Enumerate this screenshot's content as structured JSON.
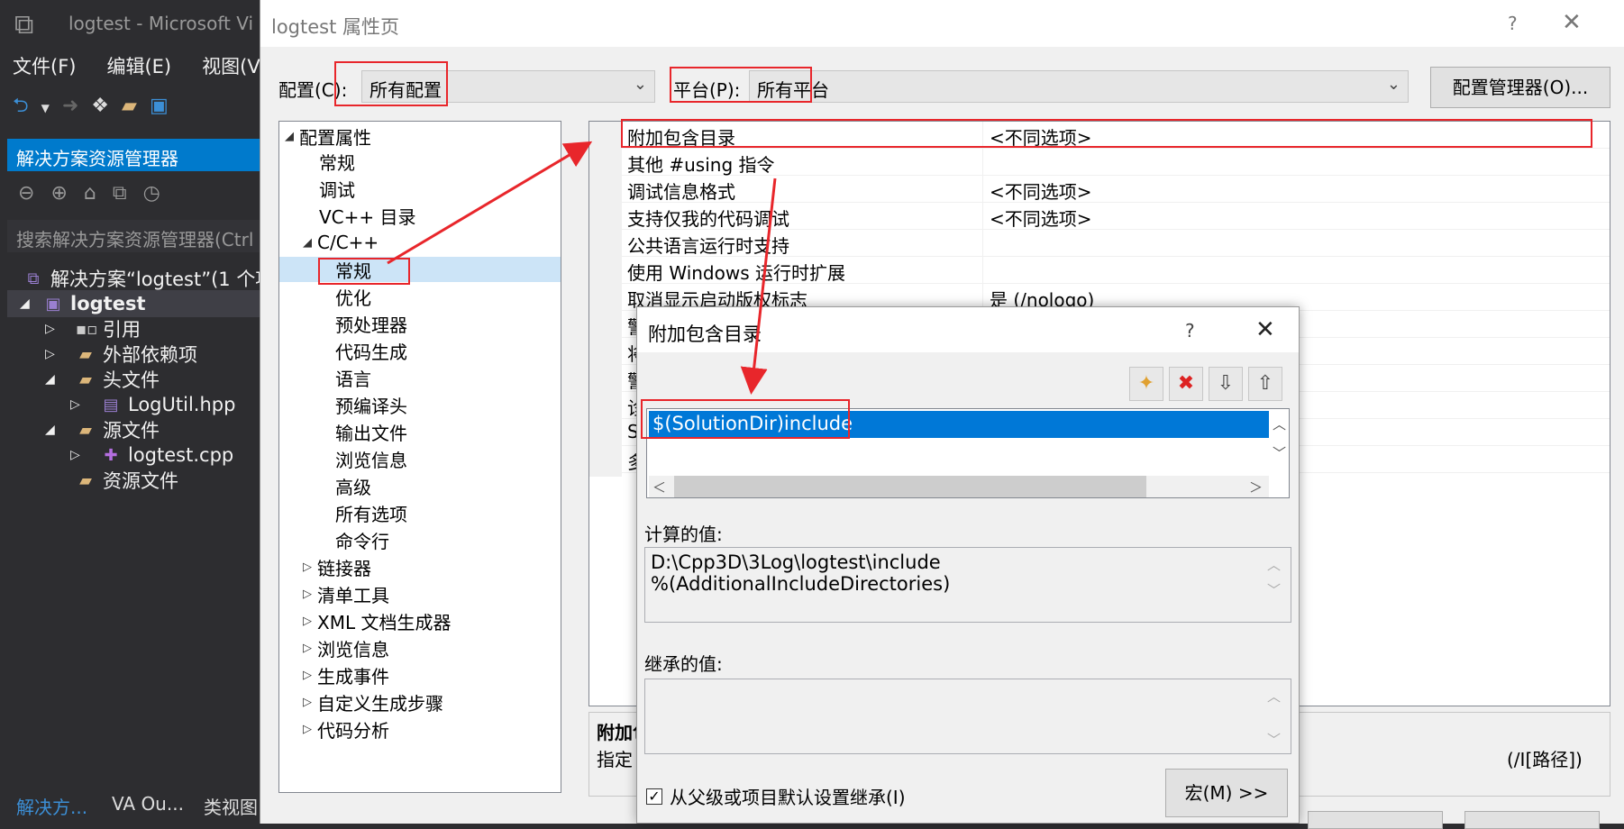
{
  "vs": {
    "title": "logtest - Microsoft Vi",
    "menu": [
      "文件(F)",
      "编辑(E)",
      "视图(V)"
    ],
    "solution_explorer": {
      "header": "解决方案资源管理器",
      "search_placeholder": "搜索解决方案资源管理器(Ctrl",
      "items": [
        {
          "label": "解决方案“logtest”(1 个项",
          "icon": "solution-icon"
        },
        {
          "label": "logtest",
          "icon": "project-icon"
        },
        {
          "label": "引用",
          "icon": "references-icon"
        },
        {
          "label": "外部依赖项",
          "icon": "external-deps-icon"
        },
        {
          "label": "头文件",
          "icon": "folder-icon"
        },
        {
          "label": "LogUtil.hpp",
          "icon": "file-icon"
        },
        {
          "label": "源文件",
          "icon": "folder-icon"
        },
        {
          "label": "logtest.cpp",
          "icon": "cpp-file-icon"
        },
        {
          "label": "资源文件",
          "icon": "folder-icon"
        }
      ],
      "tabs": [
        "解决方...",
        "VA Ou...",
        "类视图"
      ]
    }
  },
  "dialog": {
    "title": "logtest 属性页",
    "help": "?",
    "close": "✕",
    "config_label": "配置(C):",
    "config_value": "所有配置",
    "platform_label": "平台(P):",
    "platform_value": "所有平台",
    "config_manager": "配置管理器(O)...",
    "tree": [
      {
        "label": "配置属性",
        "toggle": "◢",
        "level": 0
      },
      {
        "label": "常规",
        "level": 1
      },
      {
        "label": "调试",
        "level": 1
      },
      {
        "label": "VC++ 目录",
        "level": 1
      },
      {
        "label": "C/C++",
        "toggle": "◢",
        "level": 1
      },
      {
        "label": "常规",
        "level": 2,
        "selected": true
      },
      {
        "label": "优化",
        "level": 2
      },
      {
        "label": "预处理器",
        "level": 2
      },
      {
        "label": "代码生成",
        "level": 2
      },
      {
        "label": "语言",
        "level": 2
      },
      {
        "label": "预编译头",
        "level": 2
      },
      {
        "label": "输出文件",
        "level": 2
      },
      {
        "label": "浏览信息",
        "level": 2
      },
      {
        "label": "高级",
        "level": 2
      },
      {
        "label": "所有选项",
        "level": 2
      },
      {
        "label": "命令行",
        "level": 2
      },
      {
        "label": "链接器",
        "toggle": "▷",
        "level": 1
      },
      {
        "label": "清单工具",
        "toggle": "▷",
        "level": 1
      },
      {
        "label": "XML 文档生成器",
        "toggle": "▷",
        "level": 1
      },
      {
        "label": "浏览信息",
        "toggle": "▷",
        "level": 1
      },
      {
        "label": "生成事件",
        "toggle": "▷",
        "level": 1
      },
      {
        "label": "自定义生成步骤",
        "toggle": "▷",
        "level": 1
      },
      {
        "label": "代码分析",
        "toggle": "▷",
        "level": 1
      }
    ],
    "grid": [
      {
        "name": "附加包含目录",
        "value": "<不同选项>"
      },
      {
        "name": "其他 #using 指令",
        "value": ""
      },
      {
        "name": "调试信息格式",
        "value": "<不同选项>"
      },
      {
        "name": "支持仅我的代码调试",
        "value": "<不同选项>"
      },
      {
        "name": "公共语言运行时支持",
        "value": ""
      },
      {
        "name": "使用 Windows 运行时扩展",
        "value": ""
      },
      {
        "name": "取消显示启动版权标志",
        "value": "是 (/nologo)"
      },
      {
        "name": "警",
        "value": ""
      },
      {
        "name": "将",
        "value": ""
      },
      {
        "name": "警",
        "value": ""
      },
      {
        "name": "诊",
        "value": ""
      },
      {
        "name": "S",
        "value": ""
      },
      {
        "name": "多",
        "value": ""
      }
    ],
    "desc_title": "附加包",
    "desc_text": "指定",
    "desc_suffix": "(/I[路径])"
  },
  "sub_dialog": {
    "title": "附加包含目录",
    "help": "?",
    "close": "✕",
    "list_items": [
      "$(SolutionDir)include"
    ],
    "evaluated_label": "计算的值:",
    "evaluated_lines": [
      "D:\\Cpp3D\\3Log\\logtest\\include",
      "%(AdditionalIncludeDirectories)"
    ],
    "inherited_label": "继承的值:",
    "inherit_checkbox": "从父级或项目默认设置继承(I)",
    "inherit_checked": true,
    "macro_button": "宏(M) >>"
  },
  "colors": {
    "highlight": "#e8262b",
    "selection": "#0078d7",
    "vs_accent": "#007acc"
  }
}
